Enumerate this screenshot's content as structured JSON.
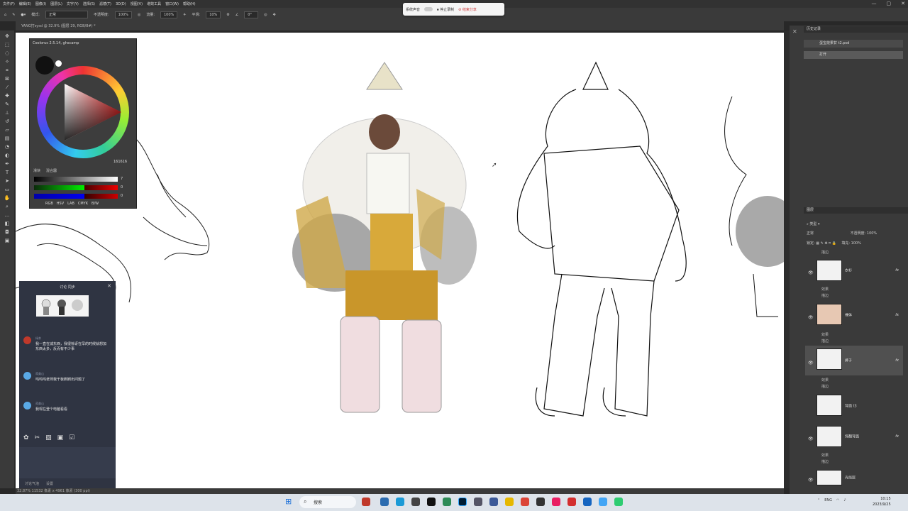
{
  "menu": [
    "文件(F)",
    "编辑(E)",
    "图像(I)",
    "图层(L)",
    "文字(Y)",
    "选择(S)",
    "滤镜(T)",
    "3D(D)",
    "视图(V)",
    "增效工具",
    "窗口(W)",
    "帮助(H)"
  ],
  "window_controls": [
    "—",
    "▢",
    "✕"
  ],
  "options": {
    "mode_label": "模式:",
    "mode_value": "正常",
    "opacity_label": "不透明度:",
    "opacity_value": "100%",
    "flow_label": "流量:",
    "flow_value": "100%",
    "smooth_label": "平滑:",
    "smooth_value": "10%",
    "angle_value": "0°"
  },
  "recorder": {
    "sound": "系统声音",
    "stop": "停止录制",
    "end": "结束分享"
  },
  "doc_tab": "YANG打sysd @ 32.9% (图层 29, RGB/8#) *",
  "status_bar": "32.87%   11532 像素 x 4961 像素 (300 ppi)",
  "color_panel": {
    "title": "Coolorus 2.5.14, ghscamp",
    "hex": "161616",
    "tabs": [
      "滑块",
      "混合器"
    ],
    "slider_values": [
      "7",
      "0",
      "0"
    ],
    "modes": [
      "RGB",
      "HSV",
      "LAB",
      "CMYK",
      "B/W"
    ]
  },
  "history": {
    "doc": "蛋宝烧果甘 t2.psd",
    "open": "打开"
  },
  "layers_panel": {
    "header": "图层",
    "filter": "类型",
    "blend": "正常",
    "opacity_label": "不透明度:",
    "opacity": "100%",
    "lock_label": "锁定:",
    "fill_label": "填充:",
    "fill": "100%",
    "layers": [
      {
        "name": "衣衫",
        "fx": "fx"
      },
      {
        "name": "裸体",
        "fx": "fx"
      },
      {
        "name": "裤子",
        "fx": "fx"
      },
      {
        "name": "背面 t3",
        "fx": ""
      },
      {
        "name": "饰翻背面",
        "fx": "fx"
      },
      {
        "name": "光线层",
        "fx": ""
      }
    ],
    "sub_effect": "效果",
    "sub_stroke": "描边",
    "top_sub": "描边"
  },
  "chat": {
    "tabs": "讨论    同步",
    "messages": [
      {
        "name": "绿茶",
        "text": "我一直在减东西，我很惊讶在早的时候就想加东西太多，反而有不少事"
      },
      {
        "name": "蒋美山",
        "text": "呜呜呜老师我干板刷刷出问题了"
      },
      {
        "name": "蒋美山",
        "text": "我现在登个电脑看看"
      }
    ],
    "footer": [
      "讨论气泡",
      "设置"
    ]
  },
  "taskbar": {
    "search": "搜索",
    "lang": "ENG",
    "time": "10:15",
    "date": "2023/9/25"
  },
  "colors": {
    "accent": "#1a6fd8",
    "panel": "#3a3a3a",
    "chat_bg": "#2f3442",
    "hat": "#e8e2c8",
    "pants": "#c9962a",
    "boots": "#f0dde0"
  }
}
